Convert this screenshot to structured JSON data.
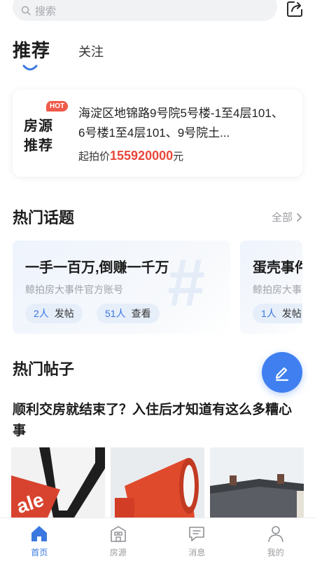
{
  "search": {
    "placeholder": "搜索"
  },
  "tabs": {
    "active": "推荐",
    "other": "关注"
  },
  "recommend_card": {
    "badge_hot": "HOT",
    "badge_line1": "房源",
    "badge_line2": "推荐",
    "title": "海淀区地锦路9号院5号楼-1至4层101、6号楼1至4层101、9号院土...",
    "price_label": "起拍价",
    "price_value": "155920000",
    "price_unit": "元"
  },
  "hot_topics": {
    "title": "热门话题",
    "see_all": "全部",
    "cards": [
      {
        "title": "一手一百万,倒赚一千万",
        "subtitle": "鲸拍房大事件官方账号",
        "post_count": "2人",
        "post_label": "发帖",
        "view_count": "51人",
        "view_label": "查看"
      },
      {
        "title": "蛋壳事件",
        "subtitle": "鲸拍房大事件",
        "post_count": "1人",
        "post_label": "发帖"
      }
    ]
  },
  "hot_posts": {
    "title": "热门帖子",
    "first_post_title": "顺利交房就结束了？入住后才知道有这么多糟心事",
    "thumb1_text": "ale"
  },
  "bottom_nav": [
    {
      "label": "首页",
      "icon": "home-icon",
      "active": true
    },
    {
      "label": "房源",
      "icon": "building-icon",
      "active": false
    },
    {
      "label": "消息",
      "icon": "message-icon",
      "active": false
    },
    {
      "label": "我的",
      "icon": "user-icon",
      "active": false
    }
  ],
  "colors": {
    "accent": "#3a78e0",
    "price": "#e8473b",
    "fab": "#3f7ff0",
    "hot_badge": "#f05a4a"
  }
}
